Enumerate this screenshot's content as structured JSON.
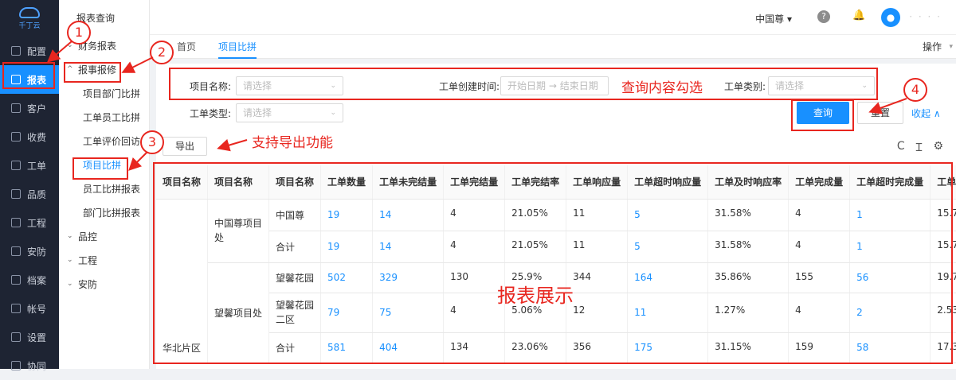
{
  "app": {
    "logo_text": "千丁云"
  },
  "rail": [
    {
      "label": "配置",
      "icon": "gear-icon"
    },
    {
      "label": "报表",
      "icon": "report-icon",
      "active": true
    },
    {
      "label": "客户",
      "icon": "user-icon"
    },
    {
      "label": "收费",
      "icon": "cash-icon"
    },
    {
      "label": "工单",
      "icon": "ticket-icon"
    },
    {
      "label": "品质",
      "icon": "quality-icon"
    },
    {
      "label": "工程",
      "icon": "engineering-icon"
    },
    {
      "label": "安防",
      "icon": "security-icon"
    },
    {
      "label": "档案",
      "icon": "archive-icon"
    },
    {
      "label": "帐号",
      "icon": "account-icon"
    },
    {
      "label": "设置",
      "icon": "settings-icon"
    },
    {
      "label": "协同",
      "icon": "collab-icon"
    }
  ],
  "submenu": {
    "head": "报表查询",
    "finance": "财务报表",
    "repair": "报事报修",
    "items": [
      "项目部门比拼",
      "工单员工比拼",
      "工单评价回访",
      "项目比拼",
      "员工比拼报表",
      "部门比拼报表"
    ],
    "quality": "品控",
    "engineering": "工程",
    "security": "安防"
  },
  "header": {
    "user": "中国尊",
    "help": "?",
    "bell": "🔔",
    "avatar": "●",
    "uname": "· · · ·"
  },
  "tabs": {
    "home": "首页",
    "current": "项目比拼",
    "ops": "操作"
  },
  "filters": {
    "project_name_label": "项目名称:",
    "project_name_placeholder": "请选择",
    "created_label": "工单创建时间:",
    "date_start": "开始日期",
    "date_arrow": "→",
    "date_end": "结束日期",
    "category_label": "工单类别:",
    "category_placeholder": "请选择",
    "type_label": "工单类型:",
    "type_placeholder": "请选择"
  },
  "buttons": {
    "query": "查询",
    "reset": "重置",
    "collapse": "收起 ∧",
    "export": "导出"
  },
  "toolbar_icons": {
    "refresh": "C",
    "density": "Ɪ",
    "settings": "⚙"
  },
  "table": {
    "headers": [
      "项目名称",
      "项目名称",
      "项目名称",
      "工单数量",
      "工单未完结量",
      "工单完结量",
      "工单完结率",
      "工单响应量",
      "工单超时响应量",
      "工单及时响应率",
      "工单完成量",
      "工单超时完成量",
      "工单"
    ],
    "region": "华北片区",
    "groups": [
      {
        "name": "中国尊项目处",
        "rows": [
          {
            "name": "中国尊",
            "c": [
              "19",
              "14",
              "4",
              "21.05%",
              "11",
              "5",
              "31.58%",
              "4",
              "1",
              "15.7"
            ]
          },
          {
            "name": "合计",
            "c": [
              "19",
              "14",
              "4",
              "21.05%",
              "11",
              "5",
              "31.58%",
              "4",
              "1",
              "15.7"
            ]
          }
        ]
      },
      {
        "name": "望馨项目处",
        "rows": [
          {
            "name": "望馨花园",
            "c": [
              "502",
              "329",
              "130",
              "25.9%",
              "344",
              "164",
              "35.86%",
              "155",
              "56",
              "19.7"
            ]
          },
          {
            "name": "望馨花园二区",
            "c": [
              "79",
              "75",
              "4",
              "5.06%",
              "12",
              "11",
              "1.27%",
              "4",
              "2",
              "2.53"
            ]
          },
          {
            "name": "合计",
            "c": [
              "581",
              "404",
              "134",
              "23.06%",
              "356",
              "175",
              "31.15%",
              "159",
              "58",
              "17.3"
            ]
          }
        ]
      }
    ]
  },
  "annotations": {
    "n1": "1",
    "n2": "2",
    "n3": "3",
    "n4": "4",
    "query_hint": "查询内容勾选",
    "export_hint": "支持导出功能",
    "table_hint": "报表展示"
  },
  "colors": {
    "accent": "#1890ff",
    "annotation": "#e8261f",
    "rail": "#1e2433"
  }
}
